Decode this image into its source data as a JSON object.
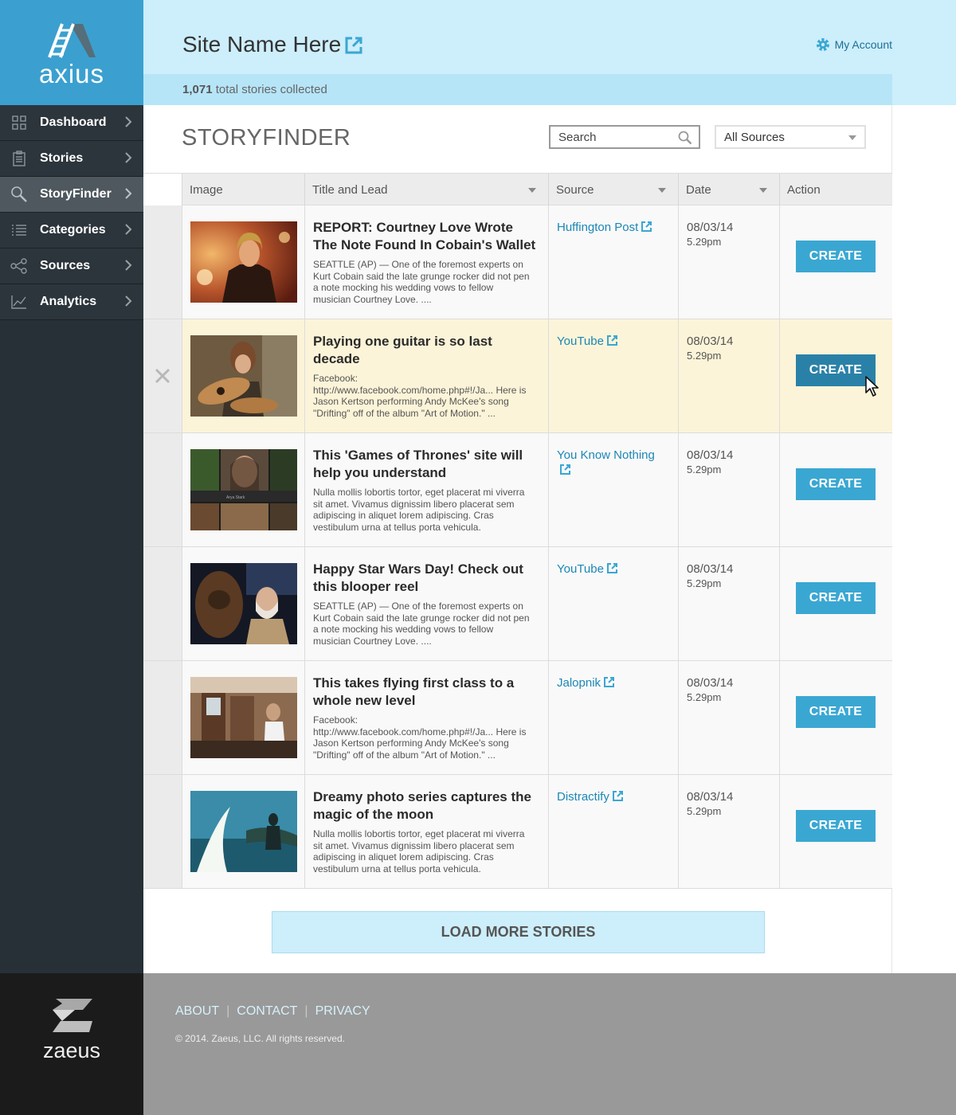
{
  "brand": {
    "name": "axius"
  },
  "sidebar": {
    "items": [
      {
        "label": "Dashboard",
        "icon": "grid-icon"
      },
      {
        "label": "Stories",
        "icon": "clipboard-icon"
      },
      {
        "label": "StoryFinder",
        "icon": "magnifier-icon",
        "active": true
      },
      {
        "label": "Categories",
        "icon": "list-icon"
      },
      {
        "label": "Sources",
        "icon": "share-nodes-icon"
      },
      {
        "label": "Analytics",
        "icon": "line-chart-icon"
      }
    ]
  },
  "header": {
    "site_title": "Site Name Here",
    "account_label": "My Account",
    "stats_count": "1,071",
    "stats_text": " total stories collected"
  },
  "finder": {
    "title": "STORYFINDER",
    "search_placeholder": "Search",
    "source_filter": "All Sources"
  },
  "table": {
    "columns": [
      "Image",
      "Title and Lead",
      "Source",
      "Date",
      "Action"
    ],
    "rows": [
      {
        "title": "REPORT: Courtney Love Wrote The Note Found In Cobain's Wallet",
        "lead": "SEATTLE (AP) — One of the foremost experts on Kurt Cobain said the late grunge rocker did not pen a note mocking his wedding vows to fellow musician Courtney Love.  ....",
        "source": "Huffington Post",
        "date": "08/03/14",
        "time": "5.29pm",
        "action": "CREATE"
      },
      {
        "title": "Playing one guitar is so last decade",
        "lead": "Facebook: http://www.facebook.com/home.php#!/Ja... Here is Jason Kertson performing Andy McKee's song \"Drifting\" off of the album \"Art of Motion.\" ...",
        "source": "YouTube",
        "date": "08/03/14",
        "time": "5.29pm",
        "action": "CREATE"
      },
      {
        "title": "This 'Games of Thrones' site will help you understand",
        "lead": "Nulla mollis lobortis tortor, eget placerat mi viverra sit amet. Vivamus dignissim libero placerat sem adipiscing in aliquet lorem adipiscing. Cras vestibulum urna at tellus porta vehicula.",
        "source": "You Know Nothing",
        "date": "08/03/14",
        "time": "5.29pm",
        "action": "CREATE",
        "thumb_caption": "Arya Stark"
      },
      {
        "title": "Happy Star Wars Day! Check out this blooper reel",
        "lead": "SEATTLE (AP) — One of the foremost experts on Kurt Cobain said the late grunge rocker did not pen a note mocking his wedding vows to fellow musician Courtney Love.  ....",
        "source": "YouTube",
        "date": "08/03/14",
        "time": "5.29pm",
        "action": "CREATE"
      },
      {
        "title": "This takes flying first class to a whole new level",
        "lead": "Facebook: http://www.facebook.com/home.php#!/Ja... Here is Jason Kertson performing Andy McKee's song \"Drifting\" off of the album \"Art of Motion.\" ...",
        "source": "Jalopnik",
        "date": "08/03/14",
        "time": "5.29pm",
        "action": "CREATE"
      },
      {
        "title": "Dreamy photo series captures the magic of the moon",
        "lead": "Nulla mollis lobortis tortor, eget placerat mi viverra sit amet. Vivamus dignissim libero placerat sem adipiscing in aliquet lorem adipiscing. Cras vestibulum urna at tellus porta vehicula.",
        "source": "Distractify",
        "date": "08/03/14",
        "time": "5.29pm",
        "action": "CREATE"
      }
    ]
  },
  "load_more": "LOAD MORE STORIES",
  "footer": {
    "brand": "zaeus",
    "links": [
      "ABOUT",
      "CONTACT",
      "PRIVACY"
    ],
    "copyright": "© 2014. Zaeus, LLC. All rights reserved."
  },
  "colors": {
    "accent": "#3aa7d2",
    "header_bg": "#cdeefb",
    "sidebar_bg": "#263036",
    "highlight_row": "#fcf4d8"
  }
}
